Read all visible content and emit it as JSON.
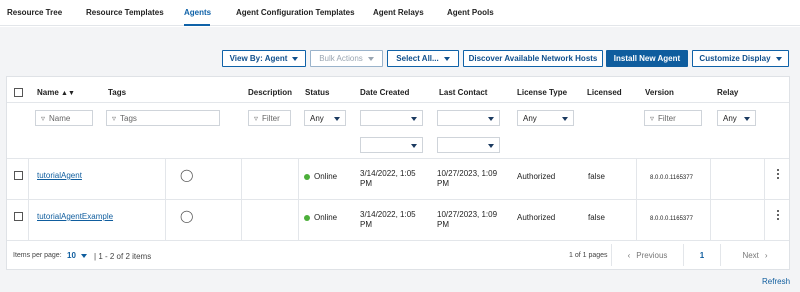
{
  "nav": {
    "tabs": [
      {
        "label": "Resource Tree"
      },
      {
        "label": "Resource Templates"
      },
      {
        "label": "Agents"
      },
      {
        "label": "Agent Configuration Templates"
      },
      {
        "label": "Agent Relays"
      },
      {
        "label": "Agent Pools"
      }
    ],
    "active": "Agents"
  },
  "toolbar": {
    "view_by": "View By: Agent",
    "bulk_actions": "Bulk Actions",
    "select_all": "Select All...",
    "discover": "Discover Available Network Hosts",
    "install": "Install New Agent",
    "customize": "Customize Display"
  },
  "table": {
    "headers": {
      "name": "Name",
      "tags": "Tags",
      "description": "Description",
      "status": "Status",
      "date_created": "Date Created",
      "last_contact": "Last Contact",
      "license_type": "License Type",
      "licensed": "Licensed",
      "version": "Version",
      "relay": "Relay"
    },
    "filters": {
      "name_placeholder": "Name",
      "tags_placeholder": "Tags",
      "description_placeholder": "Filter",
      "status_value": "Any",
      "license_type_value": "Any",
      "version_placeholder": "Filter",
      "relay_value": "Any"
    },
    "rows": [
      {
        "name": "tutorialAgent",
        "status": "Online",
        "date_created_1": "3/14/2022, 1:05",
        "date_created_2": "PM",
        "last_contact_1": "10/27/2023, 1:09",
        "last_contact_2": "PM",
        "license_type": "Authorized",
        "licensed": "false",
        "version": "8.0.0.0.1165377"
      },
      {
        "name": "tutorialAgentExample",
        "status": "Online",
        "date_created_1": "3/14/2022, 1:05",
        "date_created_2": "PM",
        "last_contact_1": "10/27/2023, 1:09",
        "last_contact_2": "PM",
        "license_type": "Authorized",
        "licensed": "false",
        "version": "8.0.0.0.1165377"
      }
    ]
  },
  "pagination": {
    "items_per_page_label": "Items per page:",
    "items_per_page": "10",
    "range": "1 - 2 of 2 items",
    "pages": "1 of 1 pages",
    "previous": "Previous",
    "current_page": "1",
    "next": "Next"
  },
  "refresh": "Refresh",
  "colors": {
    "accent": "#0f62a8",
    "online": "#4caf3a"
  },
  "icons": [
    "caret-down-icon",
    "sort-icon",
    "funnel-icon",
    "tag-icon",
    "kebab-icon",
    "chevron-left-icon",
    "chevron-right-icon"
  ]
}
